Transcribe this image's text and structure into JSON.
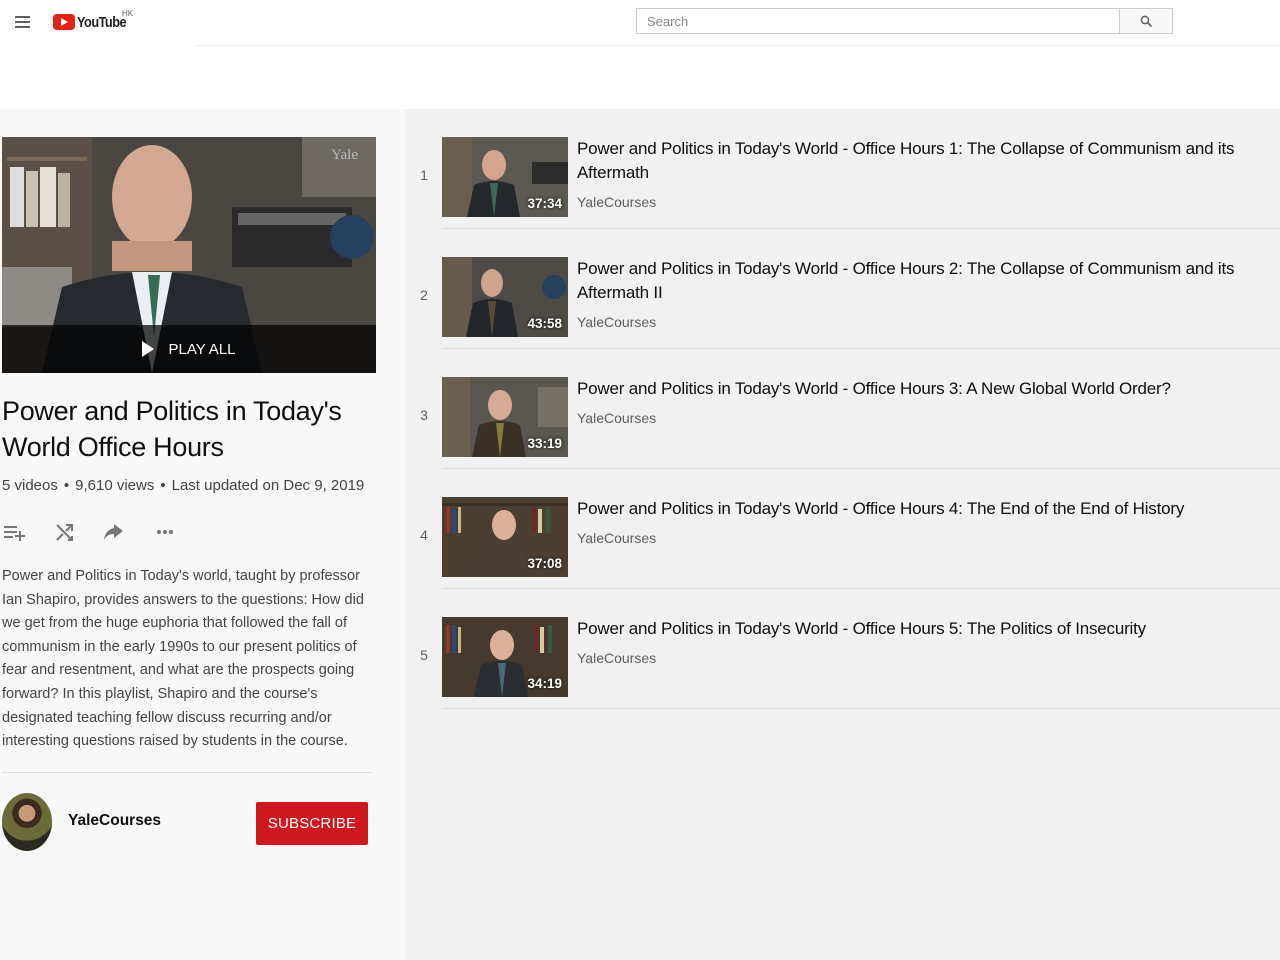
{
  "header": {
    "logo_text": "YouTube",
    "region": "HK",
    "search_placeholder": "Search"
  },
  "playlist": {
    "title": "Power and Politics in Today's World Office Hours",
    "video_count": "5 videos",
    "views": "9,610 views",
    "updated": "Last updated on Dec 9, 2019",
    "stats_sep": "•",
    "play_all": "PLAY ALL",
    "thumb_watermark": "Yale",
    "description": "Power and Politics in Today's world, taught by professor Ian Shapiro, provides answers to the questions: How did we get from the huge euphoria that followed the fall of communism in the early 1990s to our present politics of fear and resentment, and what are the prospects going forward? In this playlist, Shapiro and the course's designated teaching fellow discuss recurring and/or interesting questions raised by students in the course.",
    "owner": "YaleCourses",
    "subscribe": "SUBSCRIBE"
  },
  "videos": [
    {
      "index": "1",
      "title": "Power and Politics in Today's World - Office Hours 1: The Collapse of Communism and its Aftermath",
      "owner": "YaleCourses",
      "duration": "37:34"
    },
    {
      "index": "2",
      "title": "Power and Politics in Today's World - Office Hours 2: The Collapse of Communism and its Aftermath II",
      "owner": "YaleCourses",
      "duration": "43:58"
    },
    {
      "index": "3",
      "title": "Power and Politics in Today's World - Office Hours 3: A New Global World Order?",
      "owner": "YaleCourses",
      "duration": "33:19"
    },
    {
      "index": "4",
      "title": "Power and Politics in Today's World - Office Hours 4: The End of the End of History",
      "owner": "YaleCourses",
      "duration": "37:08"
    },
    {
      "index": "5",
      "title": "Power and Politics in Today's World - Office Hours 5: The Politics of Insecurity",
      "owner": "YaleCourses",
      "duration": "34:19"
    }
  ],
  "colors": {
    "brand_red": "#e62117",
    "subscribe_red": "#cc181e",
    "sidebar_bg": "#f8f8f8",
    "list_bg": "#f1f1f1"
  },
  "icons": {
    "menu": "hamburger-menu-icon",
    "search": "search-icon",
    "add_to_queue": "playlist-add-icon",
    "shuffle": "shuffle-icon",
    "share": "share-icon",
    "more": "more-horizontal-icon",
    "play": "play-icon"
  }
}
